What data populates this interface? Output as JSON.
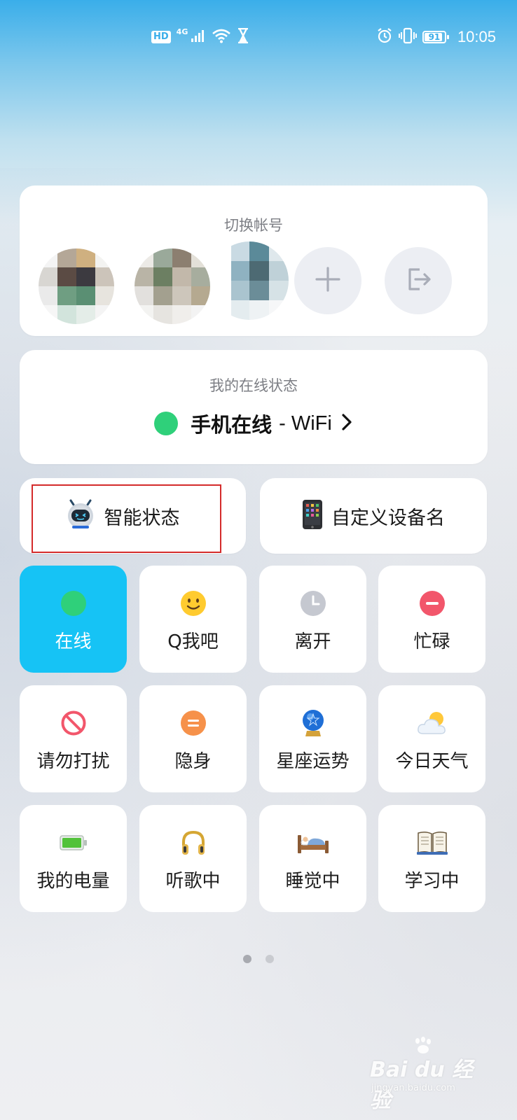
{
  "status_bar": {
    "hd": "HD",
    "network": "4G",
    "battery": "91",
    "battery_level": 0.91,
    "time": "10:05"
  },
  "account_card": {
    "title": "切换帐号",
    "add_icon": "plus-icon",
    "logout_icon": "logout-icon"
  },
  "online_card": {
    "title": "我的在线状态",
    "status": "手机在线",
    "network": "- WiFi",
    "indicator_color": "#2fd07a"
  },
  "shortcuts": {
    "smart_status": "智能状态",
    "custom_device_name": "自定义设备名"
  },
  "status_tiles": [
    {
      "label": "在线",
      "icon": "green-dot-icon",
      "active": true
    },
    {
      "label": "Q我吧",
      "icon": "smiley-icon",
      "active": false
    },
    {
      "label": "离开",
      "icon": "clock-icon",
      "active": false
    },
    {
      "label": "忙碌",
      "icon": "busy-minus-icon",
      "active": false
    },
    {
      "label": "请勿打扰",
      "icon": "do-not-disturb-icon",
      "active": false
    },
    {
      "label": "隐身",
      "icon": "invisible-icon",
      "active": false
    },
    {
      "label": "星座运势",
      "icon": "crystal-ball-icon",
      "active": false
    },
    {
      "label": "今日天气",
      "icon": "weather-icon",
      "active": false
    },
    {
      "label": "我的电量",
      "icon": "battery-icon",
      "active": false
    },
    {
      "label": "听歌中",
      "icon": "headphones-icon",
      "active": false
    },
    {
      "label": "睡觉中",
      "icon": "bed-icon",
      "active": false
    },
    {
      "label": "学习中",
      "icon": "book-icon",
      "active": false
    }
  ],
  "pager": {
    "pages": 2,
    "current": 1
  },
  "watermark": {
    "brand": "Bai du 经验",
    "site": "jingyan.baidu.com"
  },
  "colors": {
    "accent": "#16c3f5",
    "highlight_box": "#d42b2b"
  }
}
